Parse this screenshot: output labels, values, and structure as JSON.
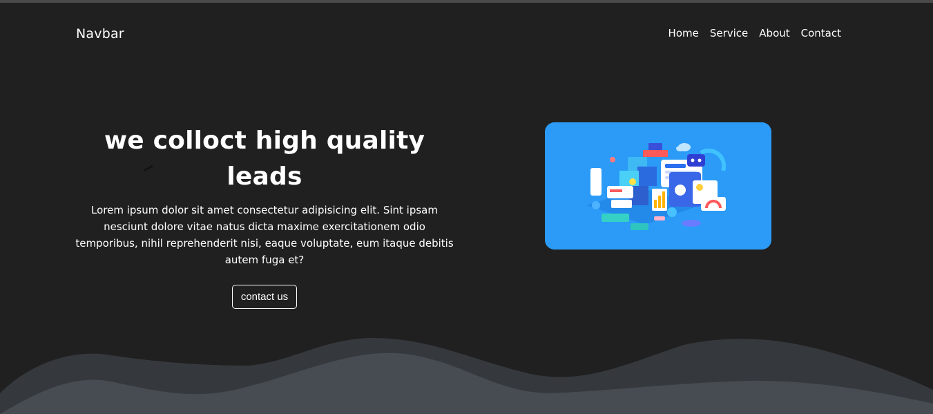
{
  "navbar": {
    "brand": "Navbar",
    "links": [
      "Home",
      "Service",
      "About",
      "Contact"
    ]
  },
  "hero": {
    "title": "we colloct high quality leads",
    "text": "Lorem ipsum dolor sit amet consectetur adipisicing elit. Sint ipsam nesciunt dolore vitae natus dicta maxime exercitationem odio temporibus, nihil reprehenderit nisi, eaque voluptate, eum itaque debitis autem fuga et?",
    "button_label": "contact us",
    "image_icon": "isometric-data-dashboard-illustration"
  },
  "colors": {
    "background": "#202020",
    "text": "#ffffff",
    "image_bg": "#2b9bf7",
    "wave_dark": "#35393d",
    "wave_light": "#474c52"
  }
}
